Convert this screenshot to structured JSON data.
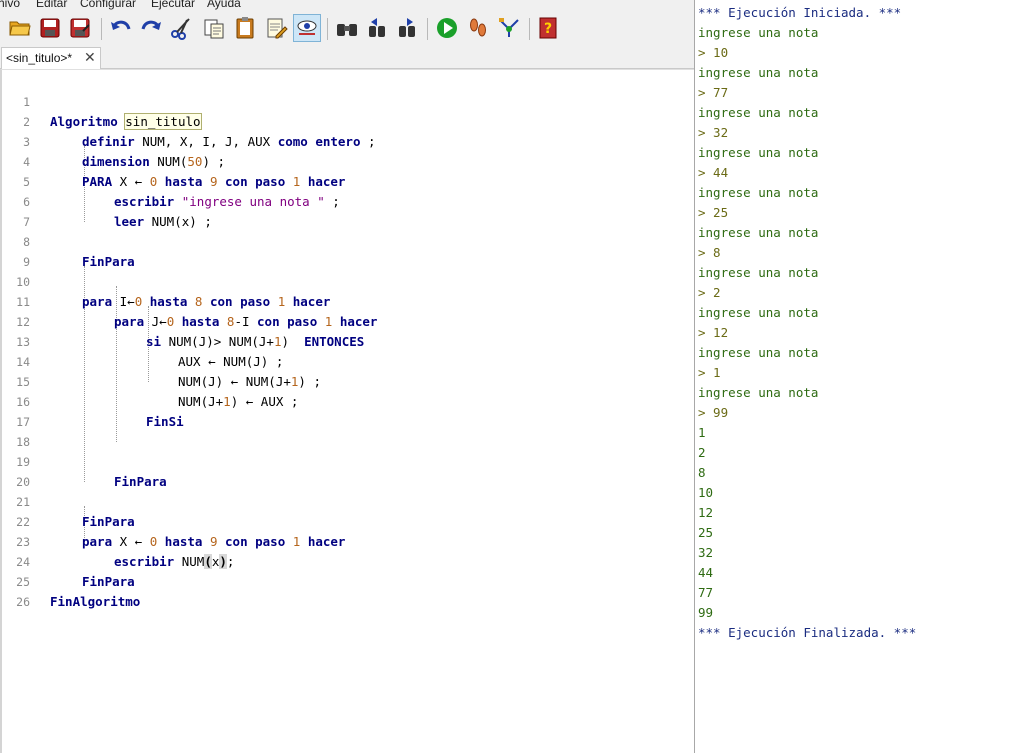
{
  "menu": [
    "hivo",
    "Editar",
    "Configurar",
    "Ejecutar",
    "Ayuda"
  ],
  "toolbar_icons": [
    "open-folder-icon",
    "save-icon",
    "save-as-icon",
    "undo-icon",
    "redo-icon",
    "cut-icon",
    "copy-icon",
    "paste-icon",
    "edit-icon",
    "step-icon",
    "search-icon",
    "replace-prev-icon",
    "replace-next-icon",
    "run-icon",
    "footsteps-icon",
    "flowchart-icon",
    "help-icon"
  ],
  "tab": {
    "label": "<sin_titulo>*",
    "close": "✕"
  },
  "editor_lines": [
    "1",
    "2",
    "3",
    "4",
    "5",
    "6",
    "7",
    "8",
    "9",
    "10",
    "11",
    "12",
    "13",
    "14",
    "15",
    "16",
    "17",
    "18",
    "19",
    "20",
    "21",
    "22",
    "23",
    "24",
    "25",
    "26"
  ],
  "code": {
    "l1": {
      "kw": "Algoritmo",
      "name": "sin_titulo"
    },
    "l2": {
      "kw": "definir",
      "vars": " NUM, X, I, J, AUX ",
      "kw2": "como entero",
      "end": " ;"
    },
    "l3": {
      "kw": "dimension",
      "a": " NUM(",
      "n": "50",
      "b": ") ;"
    },
    "l4": {
      "kw": "PARA",
      "a": " X ← ",
      "n1": "0",
      "kw2": " hasta ",
      "n2": "9",
      "kw3": " con paso ",
      "n3": "1",
      "kw4": " hacer"
    },
    "l5": {
      "kw": "escribir",
      "str": " \"ingrese una nota \"",
      "end": " ;"
    },
    "l6": {
      "kw": "leer",
      "a": " NUM(x) ;"
    },
    "l8": {
      "kw": "FinPara"
    },
    "l10": {
      "kw": "para",
      "a": " I←",
      "n1": "0",
      "kw2": " hasta ",
      "n2": "8",
      "kw3": " con paso ",
      "n3": "1",
      "kw4": " hacer"
    },
    "l11": {
      "kw": "para",
      "a": " J←",
      "n1": "0",
      "kw2": " hasta ",
      "n2": "8",
      "b": "-I",
      "kw3": " con paso ",
      "n3": "1",
      "kw4": " hacer"
    },
    "l12": {
      "kw": "si",
      "a": " NUM(J)> NUM(J+",
      "n": "1",
      "b": ")  ",
      "kw2": "ENTONCES"
    },
    "l13": {
      "a": "AUX ← NUM(J) ;"
    },
    "l14": {
      "a": "NUM(J) ← NUM(J+",
      "n": "1",
      "b": ") ;"
    },
    "l15": {
      "a": "NUM(J+",
      "n": "1",
      "b": ") ← AUX ;"
    },
    "l16": {
      "kw": "FinSi"
    },
    "l19": {
      "kw": "FinPara"
    },
    "l21": {
      "kw": "FinPara"
    },
    "l22": {
      "kw": "para",
      "a": " X ← ",
      "n1": "0",
      "kw2": " hasta ",
      "n2": "9",
      "kw3": " con paso ",
      "n3": "1",
      "kw4": " hacer"
    },
    "l23": {
      "kw": "escribir",
      "a": " NUM",
      "p1": "(",
      "b": "x",
      "p2": ")",
      "c": ";"
    },
    "l24": {
      "kw": "FinPara"
    },
    "l25": {
      "kw": "FinAlgoritmo"
    }
  },
  "console": {
    "start": "*** Ejecución Iniciada. ***",
    "prompt": "ingrese una nota",
    "inputs": [
      "> 10",
      "> 77",
      "> 32",
      "> 44",
      "> 25",
      "> 8",
      "> 2",
      "> 12",
      "> 1",
      "> 99"
    ],
    "outputs": [
      "1",
      "2",
      "8",
      "10",
      "12",
      "25",
      "32",
      "44",
      "77",
      "99"
    ],
    "end": "*** Ejecución Finalizada. ***"
  },
  "colors": {
    "keyword": "#000080",
    "number": "#b5651d",
    "string": "#800080",
    "console_system": "#1a2c80",
    "console_output": "#2e6b12",
    "console_input": "#6b6b16"
  }
}
